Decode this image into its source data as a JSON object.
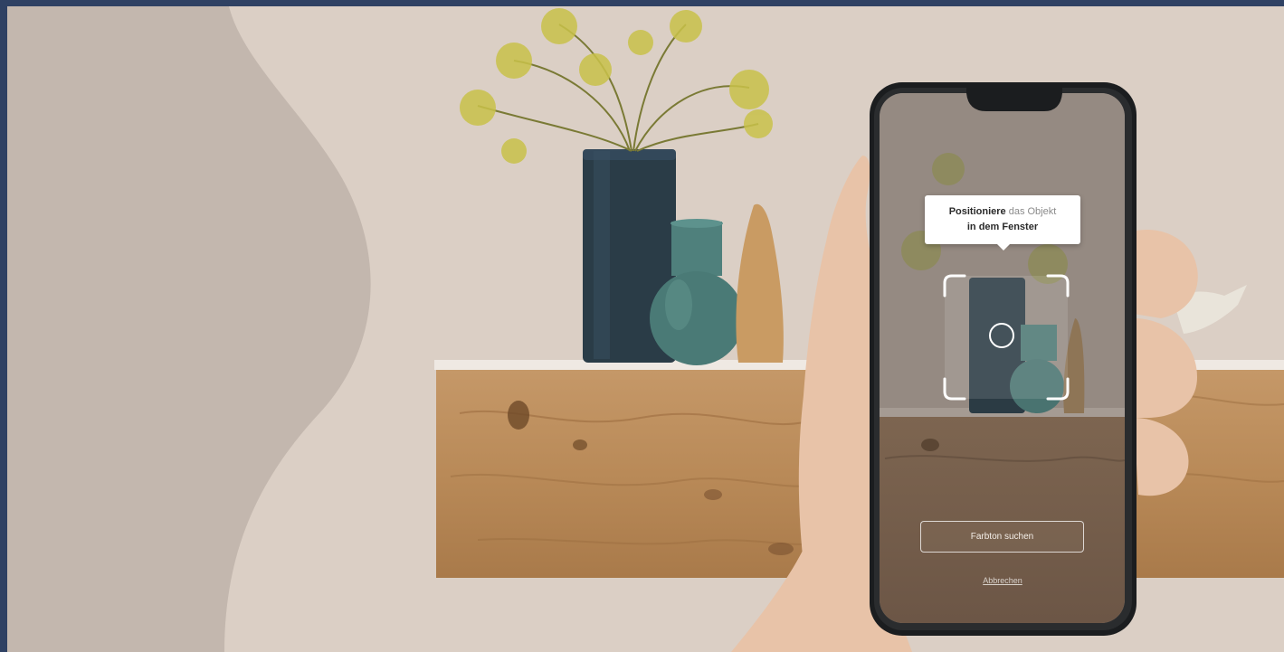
{
  "tooltip": {
    "line1_bold": "Positioniere",
    "line1_light": " das Objekt",
    "line2_bold": "in dem Fenster"
  },
  "actions": {
    "search_label": "Farbton suchen",
    "cancel_label": "Abbrechen"
  },
  "colors": {
    "frame": "#2f4163",
    "wall": "#d8ccc2",
    "wave": "#c2b6ad",
    "wood": "#b88c5c",
    "vase": "#2b3d48",
    "teal_vase": "#4e7e7a",
    "phone_body": "#1b1d1f"
  },
  "icons": [
    "scan-frame-icon",
    "focus-circle-icon",
    "phone-notch-icon"
  ]
}
